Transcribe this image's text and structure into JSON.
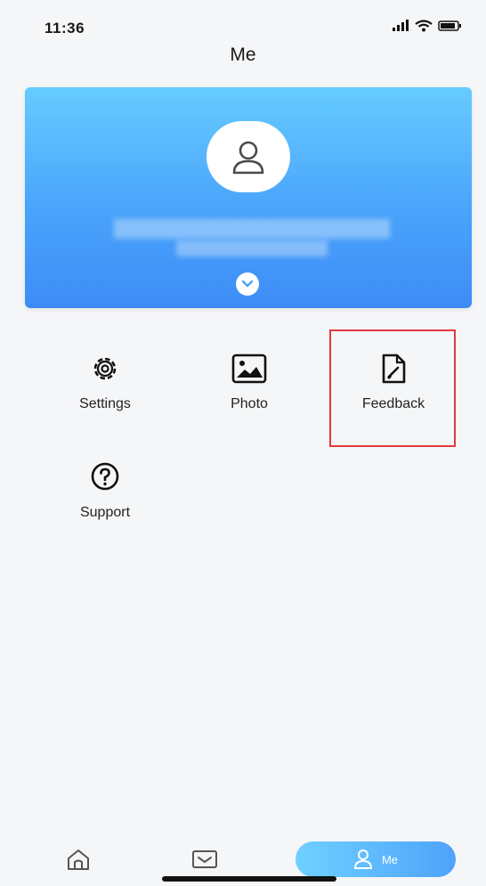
{
  "status": {
    "time": "11:36"
  },
  "header": {
    "title": "Me"
  },
  "menu": {
    "items": [
      {
        "label": "Settings",
        "icon": "gear-icon"
      },
      {
        "label": "Photo",
        "icon": "image-icon"
      },
      {
        "label": "Feedback",
        "icon": "feedback-icon"
      },
      {
        "label": "Support",
        "icon": "help-icon"
      }
    ]
  },
  "tabbar": {
    "active_label": "Me"
  },
  "colors": {
    "card_top": "#66ccff",
    "card_bottom": "#3d8cf6",
    "highlight": "#e0393e"
  }
}
